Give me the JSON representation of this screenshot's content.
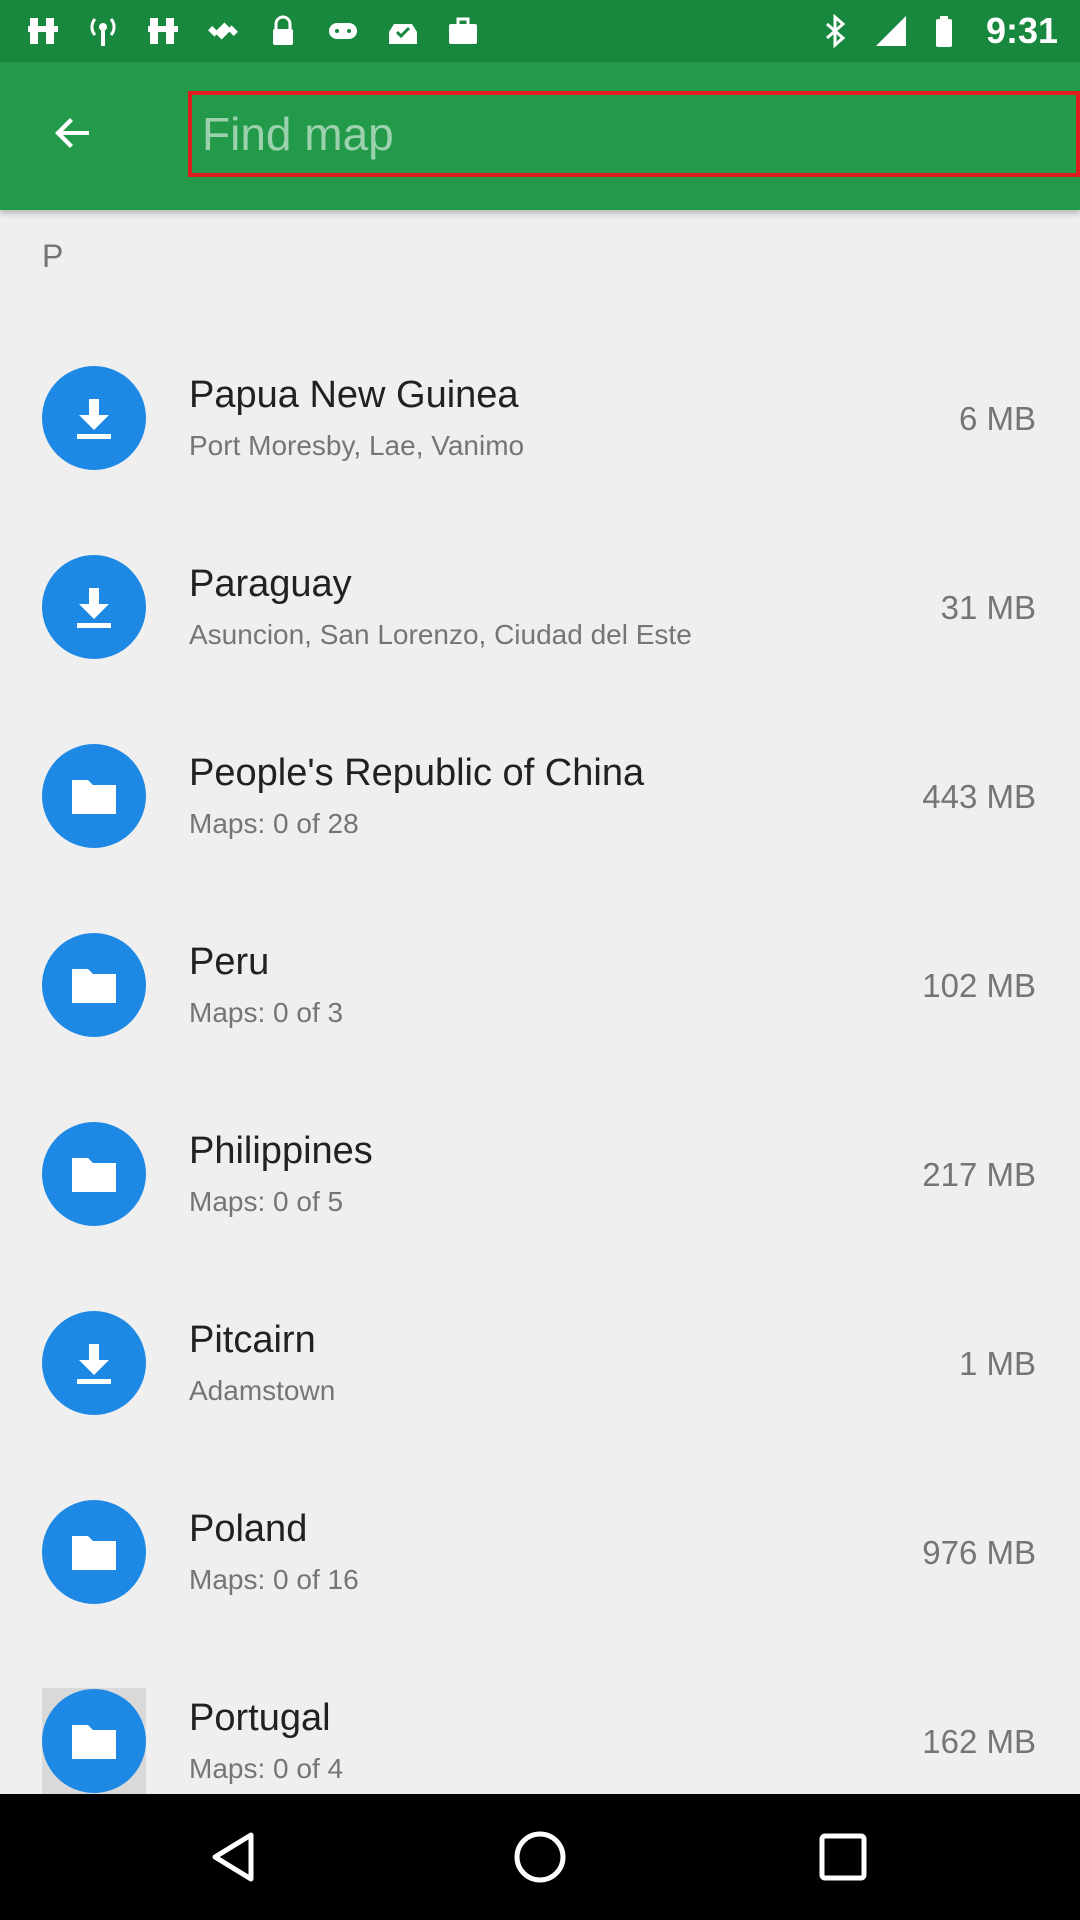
{
  "status_bar": {
    "time": "9:31",
    "left_icons": [
      "hash-icon",
      "broadcast-icon",
      "hash-icon",
      "fake-gps-icon",
      "lock-icon",
      "gamepad-icon",
      "inbox-check-icon",
      "briefcase-icon"
    ],
    "right_icons": [
      "bluetooth-icon",
      "signal-icon",
      "battery-icon"
    ]
  },
  "app_bar": {
    "search_placeholder": "Find map",
    "search_value": ""
  },
  "section_letter": "P",
  "items": [
    {
      "name": "Papua New Guinea",
      "subtitle": "Port Moresby, Lae, Vanimo",
      "size": "6 MB",
      "icon": "download-icon"
    },
    {
      "name": "Paraguay",
      "subtitle": "Asuncion, San Lorenzo, Ciudad del Este",
      "size": "31 MB",
      "icon": "download-icon"
    },
    {
      "name": "People's Republic of China",
      "subtitle": "Maps: 0 of 28",
      "size": "443 MB",
      "icon": "folder-icon"
    },
    {
      "name": "Peru",
      "subtitle": "Maps: 0 of 3",
      "size": "102 MB",
      "icon": "folder-icon"
    },
    {
      "name": "Philippines",
      "subtitle": "Maps: 0 of 5",
      "size": "217 MB",
      "icon": "folder-icon"
    },
    {
      "name": "Pitcairn",
      "subtitle": "Adamstown",
      "size": "1 MB",
      "icon": "download-icon"
    },
    {
      "name": "Poland",
      "subtitle": "Maps: 0 of 16",
      "size": "976 MB",
      "icon": "folder-icon"
    },
    {
      "name": "Portugal",
      "subtitle": "Maps: 0 of 4",
      "size": "162 MB",
      "icon": "folder-icon"
    }
  ],
  "colors": {
    "status_bar": "#17883d",
    "app_bar": "#239a4a",
    "icon_circle": "#1e88e5",
    "search_border": "#e01c1c",
    "background": "#efefef"
  },
  "nav_bar": {
    "icons": [
      "back-triangle-icon",
      "home-circle-icon",
      "recents-square-icon"
    ]
  }
}
